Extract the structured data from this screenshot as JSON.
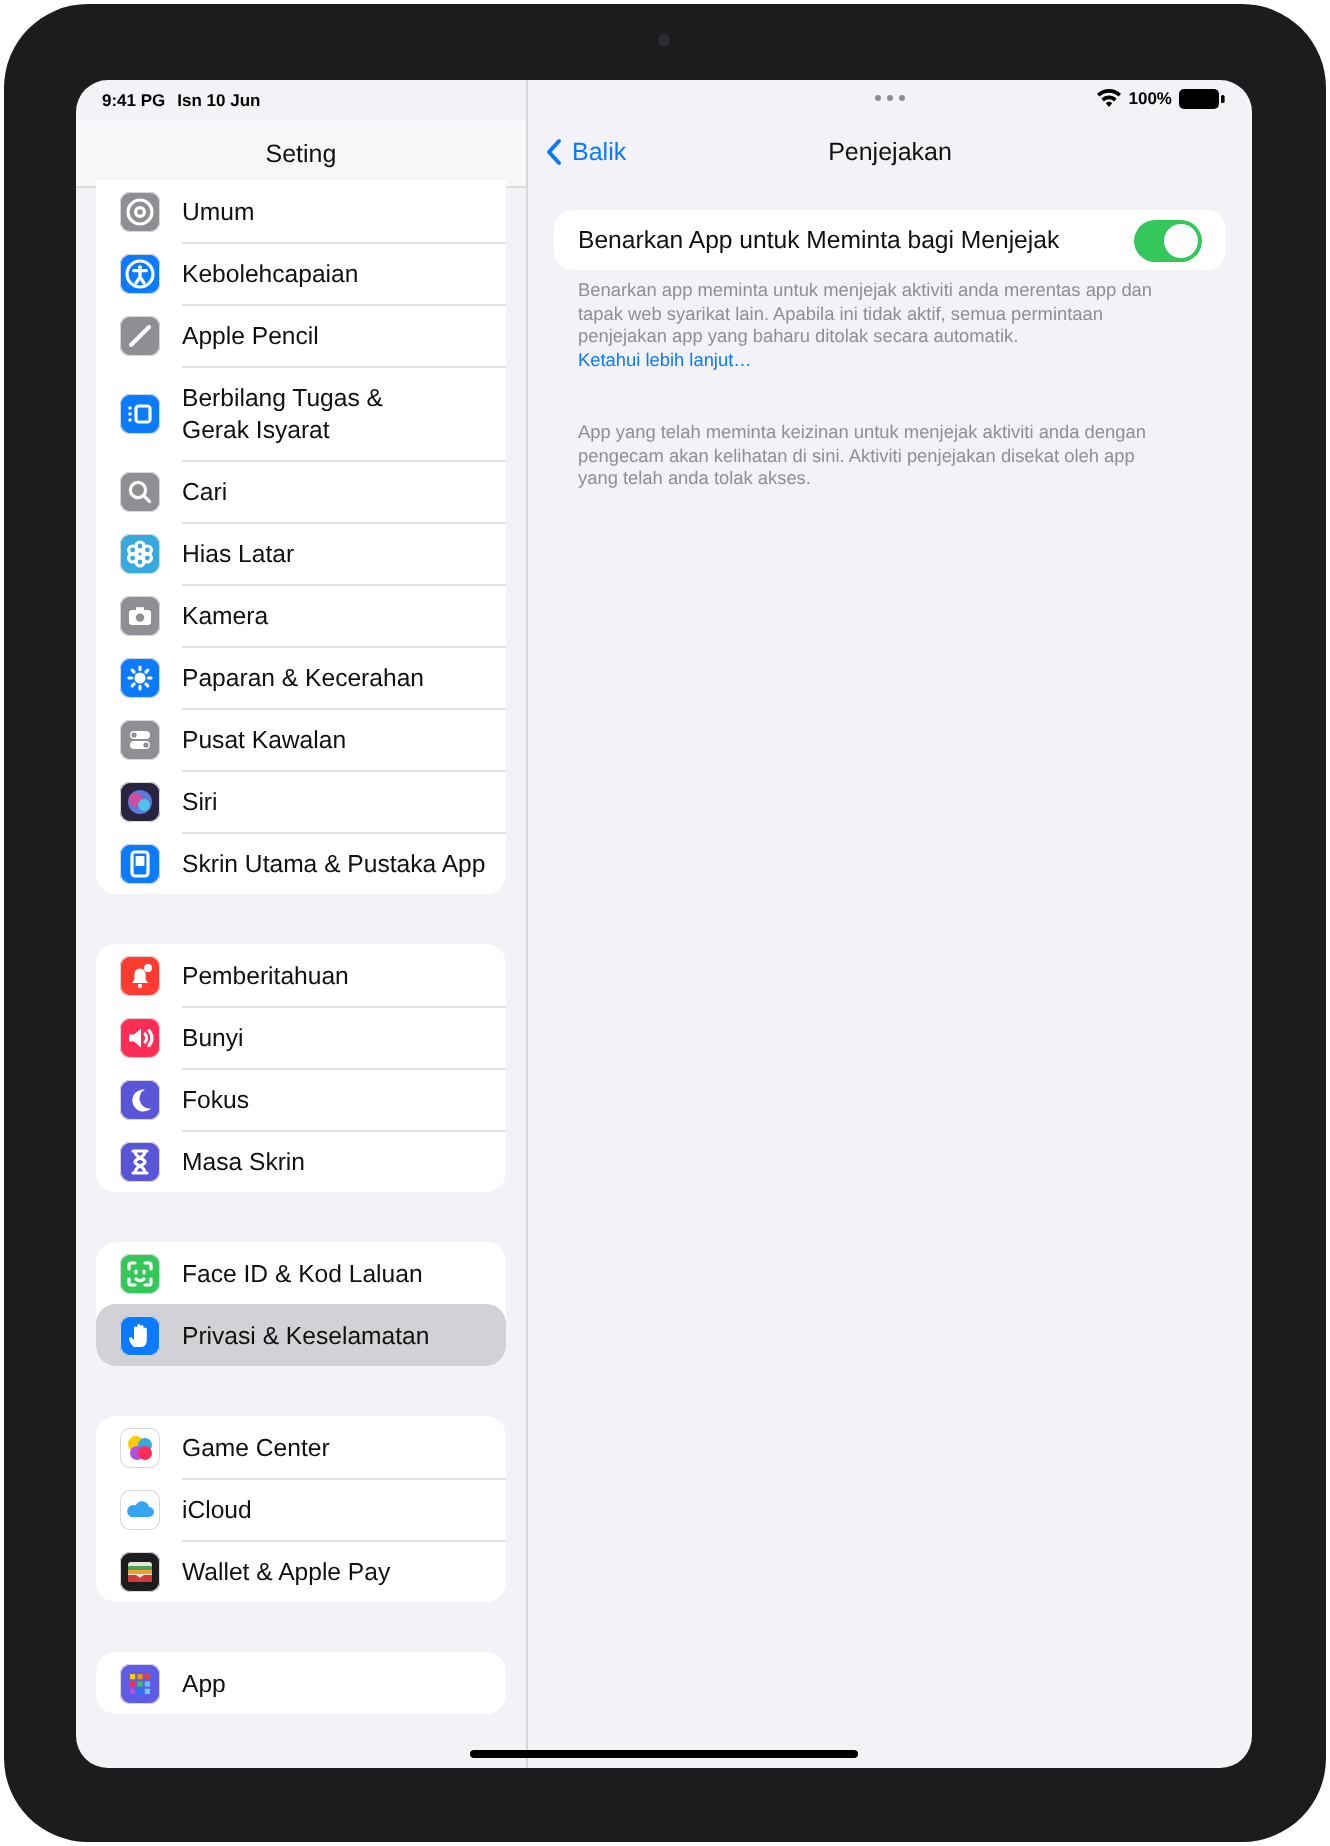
{
  "status_bar": {
    "time": "9:41 PG",
    "date": "Isn 10 Jun",
    "battery": "100%"
  },
  "sidebar": {
    "title": "Seting",
    "groups": [
      {
        "items": [
          {
            "label": "Umum",
            "color": "#8e8e93",
            "selected": false
          },
          {
            "label": "Kebolehcapaian",
            "color": "#0a7aff",
            "selected": false
          },
          {
            "label": "Apple Pencil",
            "color": "#8e8e93",
            "selected": false
          },
          {
            "label": "Berbilang Tugas &\nGerak Isyarat",
            "color": "#0a7aff",
            "selected": false
          },
          {
            "label": "Cari",
            "color": "#8e8e93",
            "selected": false
          },
          {
            "label": "Hias Latar",
            "color": "#35aadc",
            "selected": false
          },
          {
            "label": "Kamera",
            "color": "#8e8e93",
            "selected": false
          },
          {
            "label": "Paparan & Kecerahan",
            "color": "#0a7aff",
            "selected": false
          },
          {
            "label": "Pusat Kawalan",
            "color": "#8e8e93",
            "selected": false
          },
          {
            "label": "Siri",
            "color": "#2a2340",
            "selected": false
          },
          {
            "label": "Skrin Utama & Pustaka App",
            "color": "#0a7aff",
            "selected": false
          }
        ]
      },
      {
        "items": [
          {
            "label": "Pemberitahuan",
            "color": "#ff3b30",
            "selected": false
          },
          {
            "label": "Bunyi",
            "color": "#ff2d55",
            "selected": false
          },
          {
            "label": "Fokus",
            "color": "#5856d6",
            "selected": false
          },
          {
            "label": "Masa Skrin",
            "color": "#5856d6",
            "selected": false
          }
        ]
      },
      {
        "items": [
          {
            "label": "Face ID & Kod Laluan",
            "color": "#34c759",
            "selected": false
          },
          {
            "label": "Privasi & Keselamatan",
            "color": "#0a7aff",
            "selected": true
          }
        ]
      },
      {
        "items": [
          {
            "label": "Game Center",
            "color": "#ffffff",
            "selected": false
          },
          {
            "label": "iCloud",
            "color": "#ffffff",
            "selected": false
          },
          {
            "label": "Wallet & Apple Pay",
            "color": "#1c1c1e",
            "selected": false
          }
        ]
      },
      {
        "items": [
          {
            "label": "App",
            "color": "#5e5ce6",
            "selected": false
          }
        ]
      }
    ]
  },
  "detail": {
    "back": "Balik",
    "title": "Penjejakan",
    "toggle": {
      "label": "Benarkan App untuk Meminta bagi Menjejak",
      "on": true
    },
    "footer": "Benarkan app meminta untuk menjejak aktiviti anda merentas app dan tapak web syarikat lain. Apabila ini tidak aktif, semua permintaan penjejakan app yang baharu ditolak secara automatik.",
    "link": "Ketahui lebih lanjut…",
    "note": "App yang telah meminta keizinan untuk menjejak aktiviti anda dengan pengecam akan kelihatan di sini. Aktiviti penjejakan disekat oleh app yang telah anda tolak akses."
  }
}
